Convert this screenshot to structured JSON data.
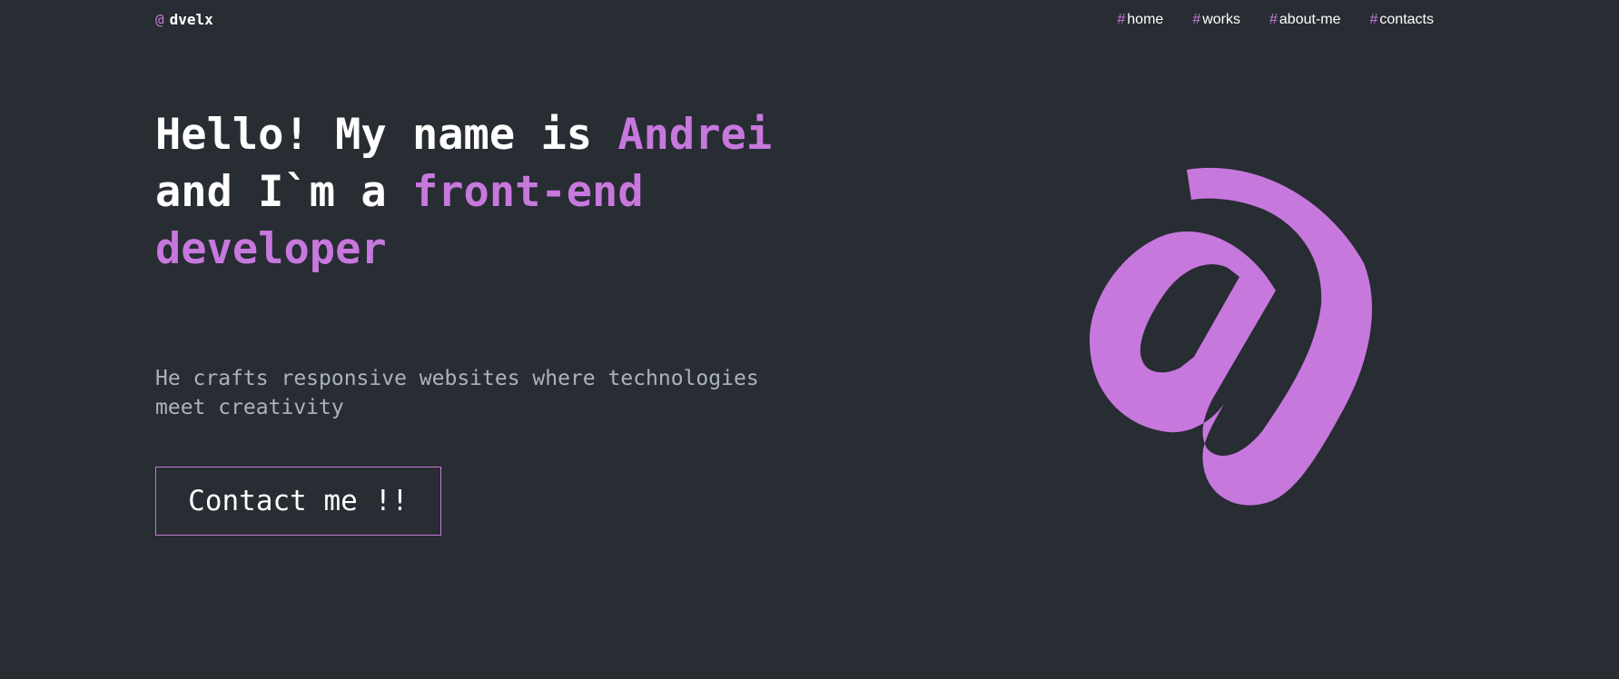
{
  "header": {
    "logo_mark": "@",
    "logo_text": "dvelx",
    "nav": [
      {
        "hash": "#",
        "label": "home"
      },
      {
        "hash": "#",
        "label": "works"
      },
      {
        "hash": "#",
        "label": "about-me"
      },
      {
        "hash": "#",
        "label": "contacts"
      }
    ]
  },
  "hero": {
    "headline_line1_plain": "Hello! My name is ",
    "headline_name": "Andrei",
    "headline_line2_plain": "and I`m a ",
    "headline_role_part1": "front-end",
    "headline_role_part2": "developer",
    "subtitle": "He crafts responsive websites where technologies meet creativity",
    "cta_label": "Contact me !!",
    "art_icon": "at-sign-icon"
  },
  "colors": {
    "background": "#282c33",
    "accent": "#c778dd",
    "text": "#ffffff",
    "muted": "#abb2bf"
  }
}
